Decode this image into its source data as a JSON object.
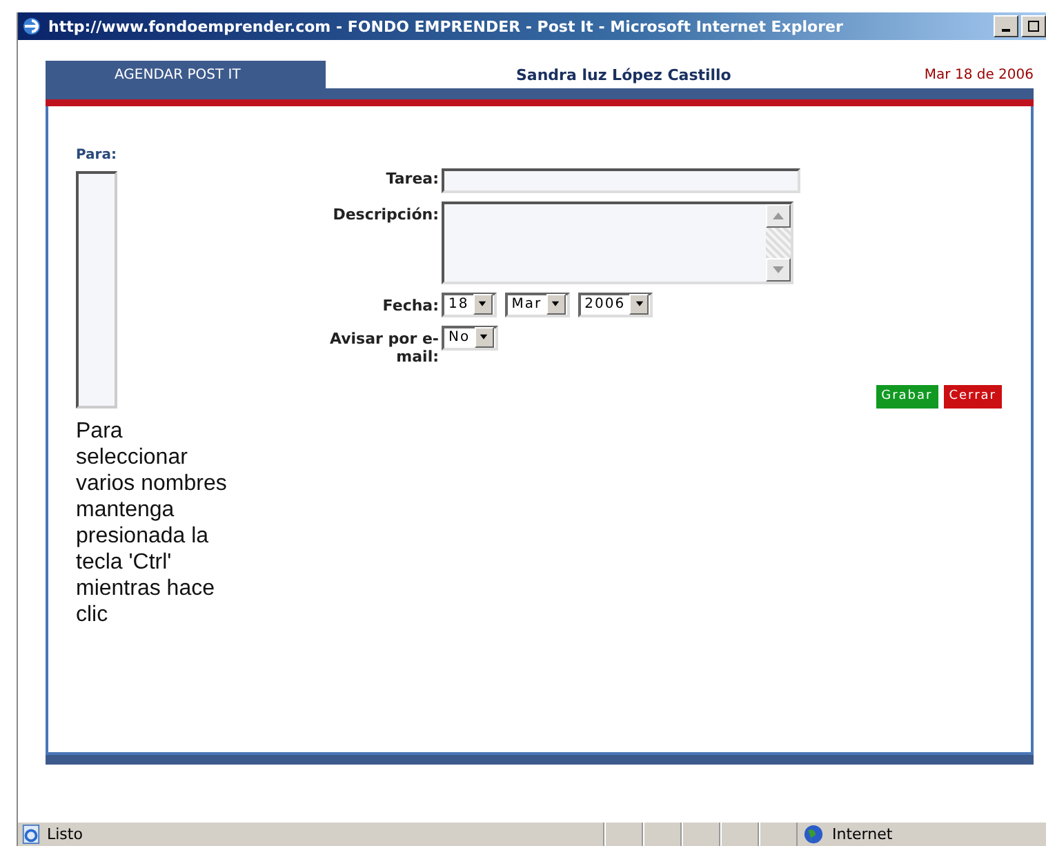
{
  "window": {
    "title": "http://www.fondoemprender.com - FONDO EMPRENDER - Post It - Microsoft Internet Explorer"
  },
  "header": {
    "tab": "AGENDAR POST IT",
    "user": "Sandra luz López Castillo",
    "date": "Mar 18 de 2006"
  },
  "recipients": {
    "label": "Para:",
    "help": "Para seleccionar varios nombres mantenga presionada la tecla 'Ctrl' mientras hace clic"
  },
  "fields": [
    {
      "kind": "text",
      "label": "Tarea:"
    },
    {
      "kind": "textarea",
      "label": "Descripción:"
    },
    {
      "kind": "selects",
      "label": "Fecha:",
      "values": [
        "18",
        "Mar",
        "2006"
      ]
    },
    {
      "kind": "selects",
      "label": "Avisar por e-mail:",
      "values": [
        "No"
      ]
    }
  ],
  "buttons": [
    {
      "kind": "save",
      "label": "Grabar"
    },
    {
      "kind": "close",
      "label": "Cerrar"
    }
  ],
  "status_bar": {
    "text": "Listo",
    "zone": "Internet"
  }
}
